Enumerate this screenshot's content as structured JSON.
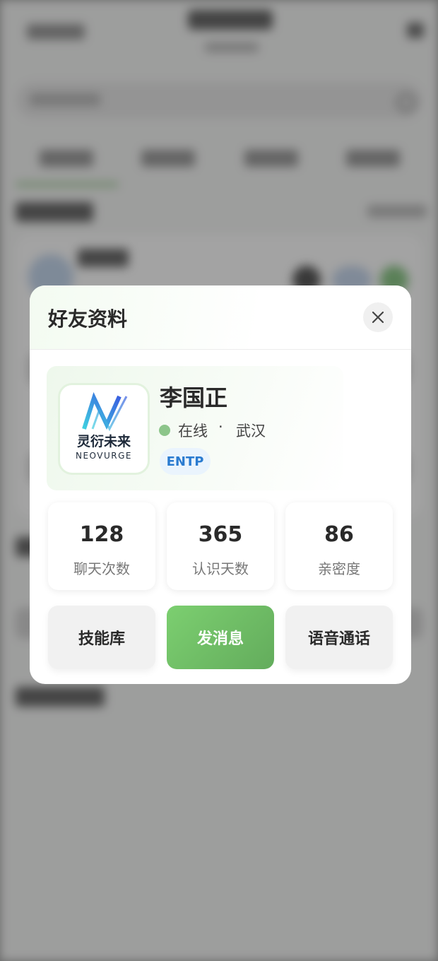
{
  "modal": {
    "title": "好友资料",
    "close_icon": "close-icon"
  },
  "profile": {
    "avatar_logo_text": "灵衍未来",
    "avatar_logo_subtext": "NEOVURGE",
    "name": "李国正",
    "status": "在线",
    "separator": "·",
    "city": "武汉",
    "mbti": "ENTP",
    "status_color": "#8cc58a"
  },
  "stats": [
    {
      "value": "128",
      "label": "聊天次数"
    },
    {
      "value": "365",
      "label": "认识天数"
    },
    {
      "value": "86",
      "label": "亲密度"
    }
  ],
  "actions": {
    "skills_label": "技能库",
    "message_label": "发消息",
    "voice_call_label": "语音通话"
  },
  "colors": {
    "accent": "#6bbd62",
    "mbti_text": "#2a7bd0",
    "mbti_bg": "#eaf4fd"
  }
}
